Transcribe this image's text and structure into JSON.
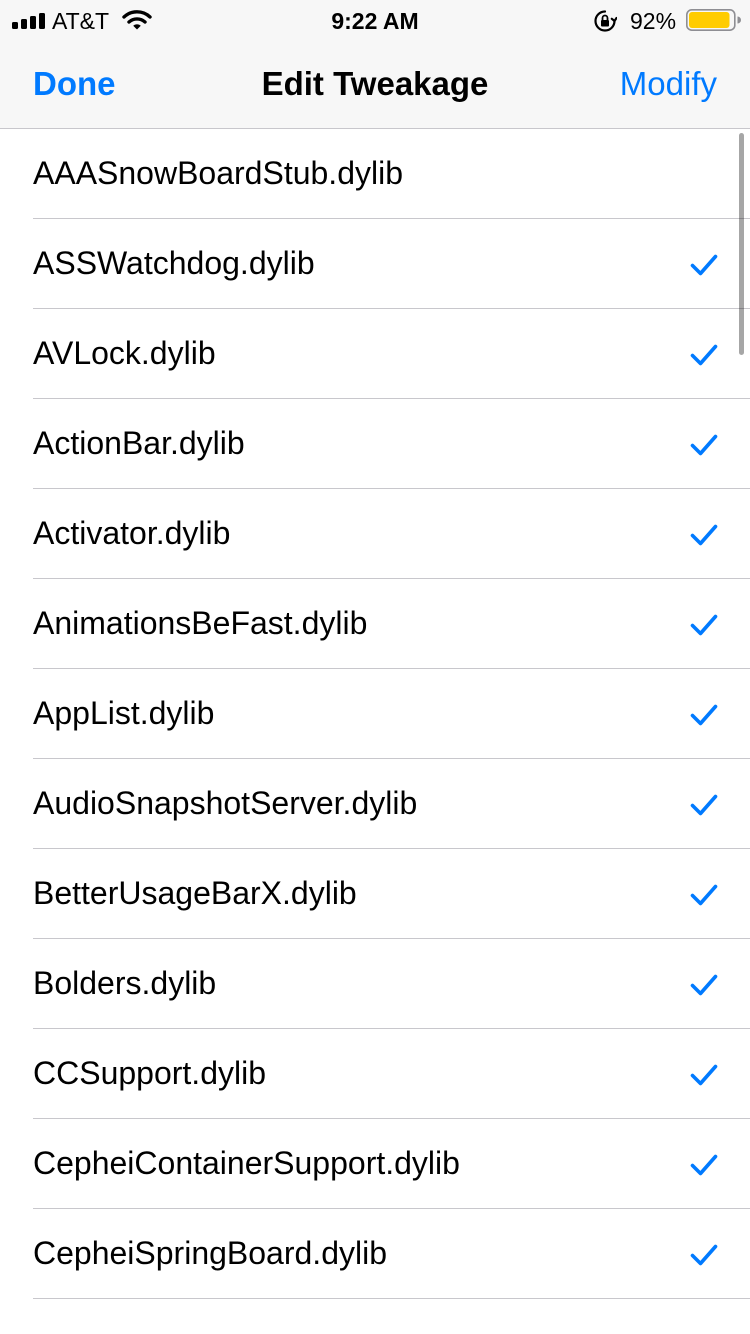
{
  "status_bar": {
    "carrier": "AT&T",
    "time": "9:22 AM",
    "battery_percent": "92%",
    "battery_level": 0.92,
    "battery_color": "#ffcc00",
    "icons": [
      "signal-bars-icon",
      "wifi-icon",
      "orientation-lock-icon",
      "battery-icon"
    ]
  },
  "nav": {
    "left_button": "Done",
    "title": "Edit Tweakage",
    "right_button": "Modify",
    "tint_color": "#007aff"
  },
  "list": {
    "checkmark_icon": "checkmark-icon",
    "items": [
      {
        "label": "AAASnowBoardStub.dylib",
        "checked": false
      },
      {
        "label": "ASSWatchdog.dylib",
        "checked": true
      },
      {
        "label": "AVLock.dylib",
        "checked": true
      },
      {
        "label": "ActionBar.dylib",
        "checked": true
      },
      {
        "label": "Activator.dylib",
        "checked": true
      },
      {
        "label": "AnimationsBeFast.dylib",
        "checked": true
      },
      {
        "label": "AppList.dylib",
        "checked": true
      },
      {
        "label": "AudioSnapshotServer.dylib",
        "checked": true
      },
      {
        "label": "BetterUsageBarX.dylib",
        "checked": true
      },
      {
        "label": "Bolders.dylib",
        "checked": true
      },
      {
        "label": "CCSupport.dylib",
        "checked": true
      },
      {
        "label": "CepheiContainerSupport.dylib",
        "checked": true
      },
      {
        "label": "CepheiSpringBoard.dylib",
        "checked": true
      }
    ]
  }
}
